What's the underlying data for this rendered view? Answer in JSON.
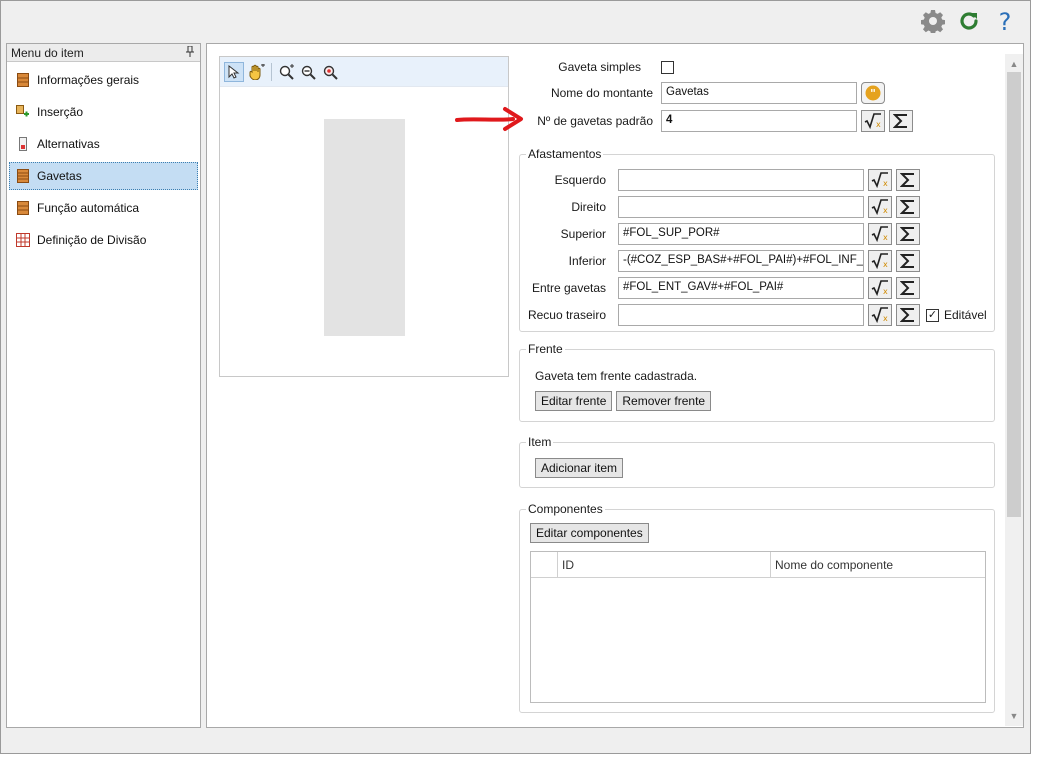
{
  "sidebar": {
    "title": "Menu do item",
    "items": [
      {
        "label": "Informações gerais",
        "icon": "drawer-icon"
      },
      {
        "label": "Inserção",
        "icon": "insert-icon"
      },
      {
        "label": "Alternativas",
        "icon": "alternatives-icon"
      },
      {
        "label": "Gavetas",
        "icon": "drawer-icon"
      },
      {
        "label": "Função automática",
        "icon": "drawer-icon"
      },
      {
        "label": "Definição de Divisão",
        "icon": "grid-icon"
      }
    ]
  },
  "form": {
    "gaveta_simples_label": "Gaveta simples",
    "nome_montante_label": "Nome do montante",
    "nome_montante_value": "Gavetas",
    "num_gavetas_label": "Nº de gavetas padrão",
    "num_gavetas_value": "4"
  },
  "afastamentos": {
    "title": "Afastamentos",
    "rows": [
      {
        "label": "Esquerdo",
        "value": ""
      },
      {
        "label": "Direito",
        "value": ""
      },
      {
        "label": "Superior",
        "value": "#FOL_SUP_POR#"
      },
      {
        "label": "Inferior",
        "value": "-(#COZ_ESP_BAS#+#FOL_PAI#)+#FOL_INF_F"
      },
      {
        "label": "Entre gavetas",
        "value": "#FOL_ENT_GAV#+#FOL_PAI#"
      },
      {
        "label": "Recuo traseiro",
        "value": ""
      }
    ],
    "editavel_label": "Editável"
  },
  "frente": {
    "title": "Frente",
    "status": "Gaveta tem frente cadastrada.",
    "edit_label": "Editar frente",
    "remove_label": "Remover frente"
  },
  "item": {
    "title": "Item",
    "add_label": "Adicionar item"
  },
  "componentes": {
    "title": "Componentes",
    "edit_label": "Editar componentes",
    "columns": [
      "ID",
      "Nome do componente"
    ]
  },
  "colors": {
    "accent_red": "#e0191c",
    "selection": "#c4ddf3",
    "refresh_green": "#2e7d32",
    "help_blue": "#2a6fb8"
  }
}
